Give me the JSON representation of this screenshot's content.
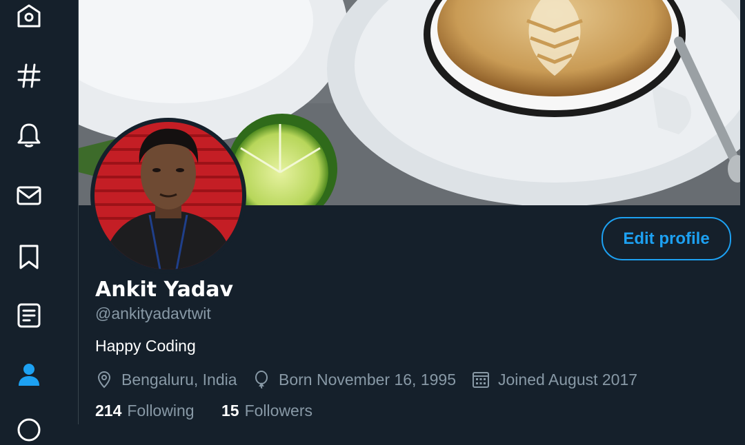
{
  "sidebar": {
    "items": [
      {
        "icon": "home-icon"
      },
      {
        "icon": "hashtag-icon"
      },
      {
        "icon": "bell-icon"
      },
      {
        "icon": "mail-icon"
      },
      {
        "icon": "bookmark-icon"
      },
      {
        "icon": "list-icon"
      },
      {
        "icon": "profile-icon",
        "active": true
      }
    ]
  },
  "profile": {
    "name": "Ankit Yadav",
    "handle": "@ankityadavtwit",
    "bio": "Happy Coding",
    "location": "Bengaluru, India",
    "birth": "Born November 16, 1995",
    "joined": "Joined August 2017",
    "following_count": "214",
    "following_label": "Following",
    "followers_count": "15",
    "followers_label": "Followers",
    "edit_label": "Edit profile"
  },
  "colors": {
    "background": "#15202b",
    "accent": "#1da1f2",
    "secondary_text": "#8899a6",
    "border": "#38444d"
  }
}
